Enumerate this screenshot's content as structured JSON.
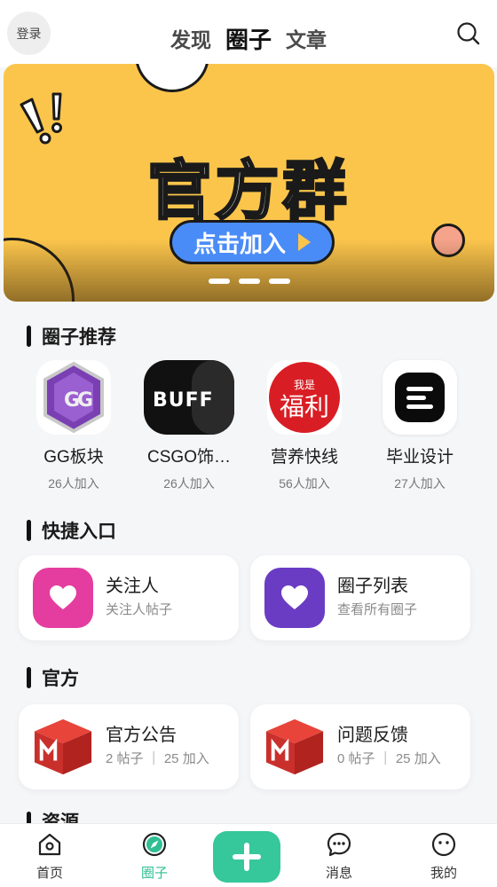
{
  "header": {
    "login_label": "登录",
    "tabs": [
      {
        "label": "发现",
        "active": false
      },
      {
        "label": "圈子",
        "active": true
      },
      {
        "label": "文章",
        "active": false
      }
    ],
    "search_icon": "search-icon"
  },
  "banner": {
    "title": "官方群",
    "button_label": "点击加入",
    "background_color": "#fbc54c",
    "indicator_count": 3
  },
  "recommend": {
    "title": "圈子推荐",
    "items": [
      {
        "name": "GG板块",
        "count": "26人加入",
        "icon": "gg-logo"
      },
      {
        "name": "CSGO饰…",
        "count": "26人加入",
        "icon": "buff-logo"
      },
      {
        "name": "营养快线",
        "count": "56人加入",
        "icon": "fuli-logo"
      },
      {
        "name": "毕业设计",
        "count": "27人加入",
        "icon": "menu-logo"
      }
    ]
  },
  "shortcuts": {
    "title": "快捷入口",
    "items": [
      {
        "title": "关注人",
        "subtitle": "关注人帖子",
        "color": "#e43d9f",
        "icon": "heart-icon"
      },
      {
        "title": "圈子列表",
        "subtitle": "查看所有圈子",
        "color": "#6a3cc4",
        "icon": "heart-icon"
      }
    ]
  },
  "official": {
    "title": "官方",
    "items": [
      {
        "title": "官方公告",
        "subtitle": "2 帖子 ｜ 25 加入",
        "icon": "m-box-icon"
      },
      {
        "title": "问题反馈",
        "subtitle": "0 帖子 ｜ 25 加入",
        "icon": "m-box-icon"
      }
    ]
  },
  "resources": {
    "title": "资源"
  },
  "bottom_nav": {
    "items": [
      {
        "label": "首页",
        "icon": "home-icon",
        "active": false
      },
      {
        "label": "圈子",
        "icon": "compass-icon",
        "active": true
      },
      {
        "label": "",
        "icon": "plus-icon",
        "active": false
      },
      {
        "label": "消息",
        "icon": "chat-icon",
        "active": false
      },
      {
        "label": "我的",
        "icon": "smile-icon",
        "active": false
      }
    ],
    "active_color": "#2fbf94",
    "add_color": "#36c79b"
  }
}
